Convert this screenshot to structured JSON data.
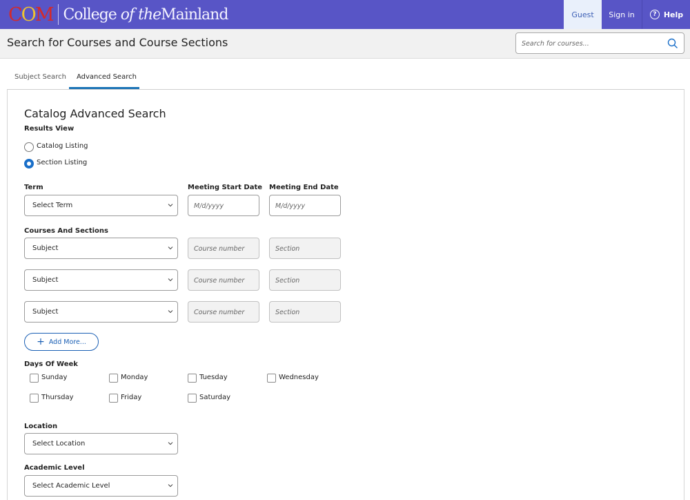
{
  "topbar": {
    "logo_letters": "COM",
    "logo_name_1": "College ",
    "logo_name_2": "of the",
    "logo_name_3": "Mainland",
    "nav": {
      "guest": "Guest",
      "signin": "Sign in",
      "help": "Help"
    },
    "bg_color": "#5855c6"
  },
  "header": {
    "title": "Search for Courses and Course Sections",
    "search_placeholder": "Search for courses..."
  },
  "tabs": [
    {
      "label": "Subject Search"
    },
    {
      "label": "Advanced Search"
    }
  ],
  "form": {
    "title": "Catalog Advanced Search",
    "results_view": {
      "label": "Results View",
      "options": [
        {
          "label": "Catalog Listing",
          "selected": false
        },
        {
          "label": "Section Listing",
          "selected": true
        }
      ]
    },
    "term": {
      "label": "Term",
      "value": "Select Term"
    },
    "start_date": {
      "label": "Meeting Start Date",
      "placeholder": "M/d/yyyy"
    },
    "end_date": {
      "label": "Meeting End Date",
      "placeholder": "M/d/yyyy"
    },
    "courses": {
      "label": "Courses And Sections",
      "rows": [
        {
          "subject": "Subject",
          "course_placeholder": "Course number",
          "section_placeholder": "Section"
        },
        {
          "subject": "Subject",
          "course_placeholder": "Course number",
          "section_placeholder": "Section"
        },
        {
          "subject": "Subject",
          "course_placeholder": "Course number",
          "section_placeholder": "Section"
        }
      ]
    },
    "add_more": "Add More...",
    "days": {
      "label": "Days Of Week",
      "items": [
        "Sunday",
        "Monday",
        "Tuesday",
        "Wednesday",
        "Thursday",
        "Friday",
        "Saturday"
      ]
    },
    "location": {
      "label": "Location",
      "value": "Select Location"
    },
    "academic_level": {
      "label": "Academic Level",
      "value": "Select Academic Level"
    }
  },
  "colors": {
    "accent": "#1a6fc9",
    "brand": "#5855c6"
  }
}
